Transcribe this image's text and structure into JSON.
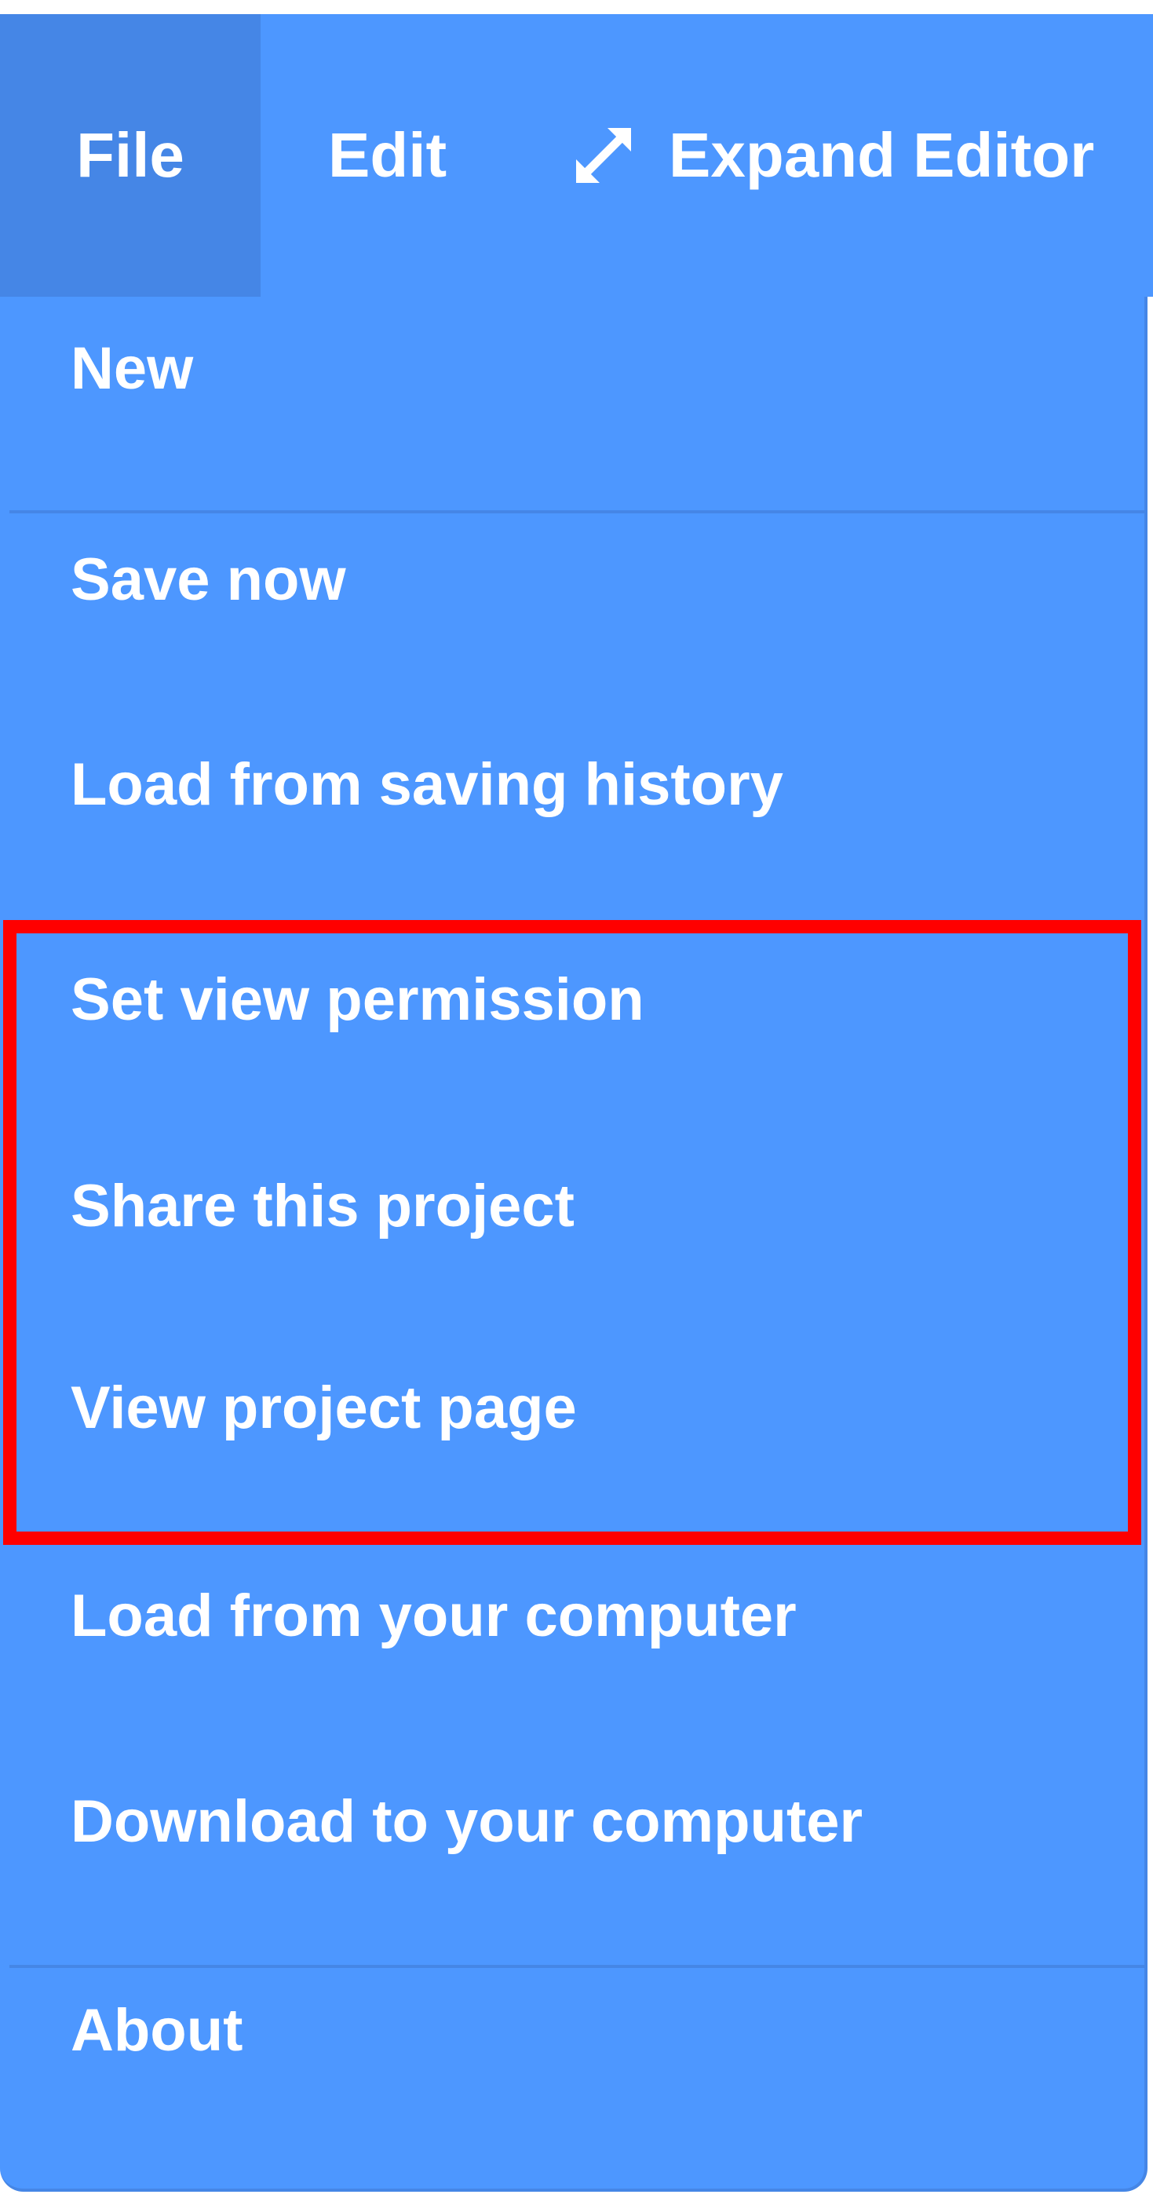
{
  "menubar": {
    "tabs": [
      {
        "label": "File",
        "icon": null
      },
      {
        "label": "Edit",
        "icon": null
      },
      {
        "label": "Expand Editor",
        "icon": "expand-arrows-icon"
      }
    ]
  },
  "file_menu": {
    "items": [
      "New",
      "Save now",
      "Load from saving history",
      "Set view permission",
      "Share this project",
      "View project page",
      "Load from your computer",
      "Download to your computer",
      "About"
    ],
    "highlighted_items": [
      "Set view permission",
      "Share this project",
      "View project page"
    ]
  },
  "colors": {
    "menu_background": "#4d97ff",
    "active_tab": "#4586e6",
    "separator": "#4586e6",
    "text": "#ffffff",
    "highlight_border": "#ff0000"
  }
}
